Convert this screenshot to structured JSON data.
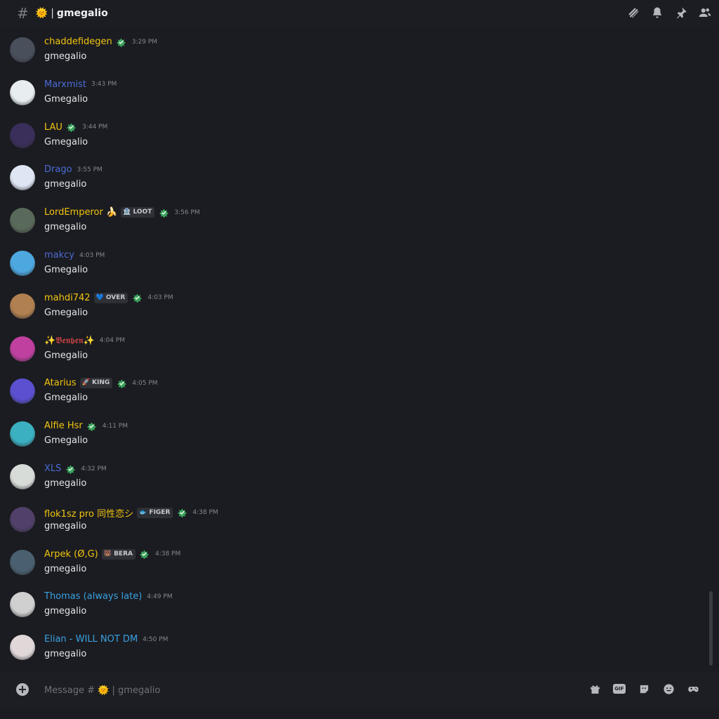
{
  "header": {
    "channel_prefix": "#",
    "channel_emoji": "🌞",
    "channel_separator": "|",
    "channel_name": "gmegalio",
    "icons": [
      "threads-icon",
      "bell-icon",
      "pin-icon",
      "members-icon"
    ]
  },
  "messages": [
    {
      "username": "chaddefidegen",
      "color": "#f1c40f",
      "badge": true,
      "role": "",
      "time": "3:29 PM",
      "text": "gmegalio",
      "avatar": "#4a4f5c"
    },
    {
      "username": "Marxmist",
      "color": "#4a6cd4",
      "badge": false,
      "role": "",
      "time": "3:43 PM",
      "text": "Gmegalio",
      "avatar": "#e8eef0"
    },
    {
      "username": "LAU",
      "color": "#f1c40f",
      "badge": true,
      "role": "",
      "time": "3:44 PM",
      "text": "Gmegalio",
      "avatar": "#3a2e5a"
    },
    {
      "username": "Drago",
      "color": "#4a6cd4",
      "badge": false,
      "role": "",
      "time": "3:55 PM",
      "text": "gmegalio",
      "avatar": "#dfe6f3"
    },
    {
      "username": "LordEmperor 🍌",
      "color": "#f1c40f",
      "badge": true,
      "role": "🏦 LOOT",
      "time": "3:56 PM",
      "text": "gmegalio",
      "avatar": "#5a6a5a"
    },
    {
      "username": "makcy",
      "color": "#4a6cd4",
      "badge": false,
      "role": "",
      "time": "4:03 PM",
      "text": "Gmegalio",
      "avatar": "#4da8e0"
    },
    {
      "username": "mahdi742",
      "color": "#f1c40f",
      "badge": true,
      "role": "💙 OVER",
      "time": "4:03 PM",
      "text": "Gmegalio",
      "avatar": "#b08050"
    },
    {
      "username": "✨𝕭𝖊𝖓𝖇𝖊𝖓✨",
      "color": "#d04545",
      "badge": false,
      "role": "",
      "time": "4:04 PM",
      "text": "Gmegalio",
      "avatar": "#c040a0"
    },
    {
      "username": "Atarius",
      "color": "#f1c40f",
      "badge": true,
      "role": "🚀 KING",
      "time": "4:05 PM",
      "text": "Gmegalio",
      "avatar": "#5a50d0"
    },
    {
      "username": "Alfie Hsr",
      "color": "#f1c40f",
      "badge": true,
      "role": "",
      "time": "4:11 PM",
      "text": "Gmegalio",
      "avatar": "#3ab0c0"
    },
    {
      "username": "XLS",
      "color": "#4a6cd4",
      "badge": true,
      "role": "",
      "time": "4:32 PM",
      "text": "gmegalio",
      "avatar": "#d8dcd8"
    },
    {
      "username": "flok1sz pro 同性恋シ",
      "color": "#f1c40f",
      "badge": true,
      "role": "🐟 FIGER",
      "time": "4:38 PM",
      "text": "gmegalio",
      "avatar": "#50406a"
    },
    {
      "username": "Arpek (Ø,G)",
      "color": "#f1c40f",
      "badge": true,
      "role": "🐻 BERA",
      "time": "4:38 PM",
      "text": "gmegalio",
      "avatar": "#4a6070"
    },
    {
      "username": "Thomas (always late)",
      "color": "#3aa0e0",
      "badge": false,
      "role": "",
      "time": "4:49 PM",
      "text": "gmegalio",
      "avatar": "#d0d0d0"
    },
    {
      "username": "Elian - WILL NOT DM",
      "color": "#3aa0e0",
      "badge": false,
      "role": "",
      "time": "4:50 PM",
      "text": "gmegalio",
      "avatar": "#e0d8d8"
    }
  ],
  "composer": {
    "placeholder": "Message # 🌞 | gmegalio",
    "gif_label": "GIF",
    "icons": [
      "gift-icon",
      "gif-icon",
      "sticker-icon",
      "emoji-icon",
      "apps-icon"
    ]
  }
}
